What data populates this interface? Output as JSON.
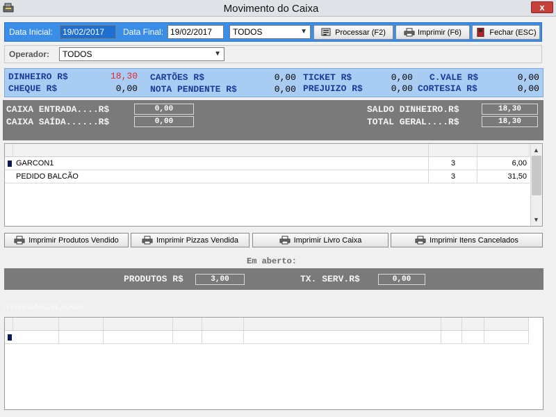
{
  "window": {
    "title": "Movimento do Caixa",
    "close_glyph": "x"
  },
  "filters": {
    "data_inicial_label": "Data Inicial:",
    "data_inicial_value": "19/02/2017",
    "data_final_label": "Data Final:",
    "data_final_value": "19/02/2017",
    "tipo_select": "TODOS",
    "operador_label": "Operador:",
    "operador_select": "TODOS"
  },
  "toolbar": {
    "processar": "Processar (F2)",
    "imprimir": "Imprimir (F6)",
    "fechar": "Fechar (ESC)"
  },
  "summary": {
    "dinheiro_label": "DINHEIRO R$",
    "dinheiro_value": "18,30",
    "cheque_label": "CHEQUE R$",
    "cheque_value": "0,00",
    "cartoes_label": "CARTÕES R$",
    "cartoes_value": "0,00",
    "nota_pendente_label": "NOTA PENDENTE R$",
    "nota_pendente_value": "0,00",
    "ticket_label": "TICKET R$",
    "ticket_value": "0,00",
    "prejuizo_label": "PREJUIZO R$",
    "prejuizo_value": "0,00",
    "cvale_label": "C.VALE R$",
    "cvale_value": "0,00",
    "cortesia_label": "CORTESIA R$",
    "cortesia_value": "0,00",
    "highlight_color": "#e0262b"
  },
  "caixa": {
    "entrada_label": "CAIXA ENTRADA....R$",
    "entrada_value": "0,00",
    "saida_label": "CAIXA SAÍDA......R$",
    "saida_value": "0,00",
    "saldo_label": "SALDO DINHEIRO.R$",
    "saldo_value": "18,30",
    "total_label": "TOTAL GERAL....R$",
    "total_value": "18,30"
  },
  "operators_grid": {
    "rows": [
      {
        "nome": "GARCON1",
        "qtd": "3",
        "valor": "6,00"
      },
      {
        "nome": "PEDIDO BALCÃO",
        "qtd": "3",
        "valor": "31,50"
      }
    ]
  },
  "print_buttons": {
    "produtos": "Imprimir Produtos Vendido",
    "pizzas": "Imprimir Pizzas Vendida",
    "livro": "Imprimir Livro Caixa",
    "cancelados": "Imprimir Itens Cancelados"
  },
  "em_aberto": {
    "title": "Em aberto:",
    "produtos_label": "PRODUTOS R$",
    "produtos_value": "3,00",
    "txserv_label": "TX. SERV.R$",
    "txserv_value": "0,00"
  },
  "itens_cancelados": {
    "title": "ITENS CANCELADOS:"
  }
}
